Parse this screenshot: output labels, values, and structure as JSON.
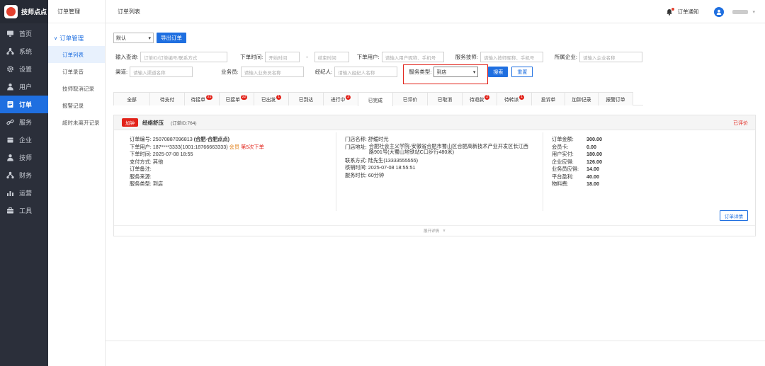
{
  "app": {
    "name": "技师点点"
  },
  "sidebar": {
    "items": [
      {
        "label": "首页",
        "icon": "monitor-icon"
      },
      {
        "label": "系统",
        "icon": "org-icon"
      },
      {
        "label": "设置",
        "icon": "gear-icon"
      },
      {
        "label": "用户",
        "icon": "user-icon"
      },
      {
        "label": "订单",
        "icon": "order-icon",
        "active": true
      },
      {
        "label": "服务",
        "icon": "link-icon"
      },
      {
        "label": "企业",
        "icon": "building-icon"
      },
      {
        "label": "技师",
        "icon": "user-icon"
      },
      {
        "label": "财务",
        "icon": "org-icon"
      },
      {
        "label": "运营",
        "icon": "chart-icon"
      },
      {
        "label": "工具",
        "icon": "briefcase-icon"
      }
    ]
  },
  "subnav": {
    "header": "订单管理",
    "group": "订单管理",
    "items": [
      {
        "label": "订单列表",
        "active": true
      },
      {
        "label": "订单录音"
      },
      {
        "label": "技师取消记录"
      },
      {
        "label": "报警记录"
      },
      {
        "label": "超时未离开记录"
      }
    ]
  },
  "header": {
    "title": "订单列表",
    "notification": "订单通知"
  },
  "toolbar": {
    "default_select": "默认",
    "export_button": "导出订单"
  },
  "filters": {
    "query_label": "输入查询:",
    "query_placeholder": "订单ID/订单编号/联系方式",
    "time_label": "下单时间:",
    "start_placeholder": "开始时间",
    "range_sep": "-",
    "end_placeholder": "结束时间",
    "user_label": "下单用户:",
    "user_placeholder": "请输入用户昵称、手机号",
    "tech_label": "服务技师:",
    "tech_placeholder": "请输入技师昵称、手机号",
    "company_label": "所属企业:",
    "company_placeholder": "请输入企业名称",
    "channel_label": "渠道:",
    "channel_placeholder": "请输入渠道名称",
    "salesman_label": "业务员:",
    "salesman_placeholder": "请输入业务员名称",
    "broker_label": "经纪人:",
    "broker_placeholder": "请输入经纪人名称",
    "service_type_label": "服务类型:",
    "service_type_value": "到店",
    "search_button": "搜索",
    "reset_button": "重置"
  },
  "tabs": [
    {
      "label": "全部",
      "w": 52
    },
    {
      "label": "待支付",
      "w": 50
    },
    {
      "label": "待接单",
      "badge": "21",
      "w": 50
    },
    {
      "label": "已接单",
      "badge": "22",
      "w": 50
    },
    {
      "label": "已出发",
      "badge": "1",
      "w": 50
    },
    {
      "label": "已到达",
      "w": 50
    },
    {
      "label": "进行中",
      "badge": "2",
      "w": 50
    },
    {
      "label": "已完成",
      "active": true,
      "w": 50
    },
    {
      "label": "已评价",
      "w": 50
    },
    {
      "label": "已取消",
      "w": 50
    },
    {
      "label": "待退款",
      "badge": "2",
      "w": 50
    },
    {
      "label": "待转派",
      "badge": "1",
      "w": 50
    },
    {
      "label": "投诉单",
      "w": 48
    },
    {
      "label": "加钟记录",
      "w": 48
    },
    {
      "label": "报警订单",
      "w": 50
    }
  ],
  "order": {
    "tag": "加钟",
    "shop_name": "经络舒压",
    "order_id": "(订单ID:764)",
    "status": "已评价",
    "left": {
      "order_no_label": "订单编号:",
      "order_no": "25070887096813",
      "order_no_city": "(合肥-合肥点点)",
      "user_label": "下单用户:",
      "user": "187****3333(1001:18766663333)",
      "member": "会员",
      "order_count": "第5次下单",
      "time_label": "下单时间:",
      "time": "2025-07-08 18:55",
      "pay_label": "支付方式:",
      "pay": "其他",
      "remark_label": "订单备注:",
      "remark": "",
      "source_label": "服务来源:",
      "source": "",
      "type_label": "服务类型:",
      "type": "到店"
    },
    "middle": {
      "store_label": "门店名称:",
      "store": "舒缓时光",
      "addr_label": "门店地址:",
      "addr": "合肥社会主义学院-安徽省合肥市蜀山区合肥高新技术产业开发区长江西路901号(大蜀山地铁站C口步行480米)",
      "contact_label": "联系方式:",
      "contact": "陆先生(13333555555)",
      "verify_label": "核销时间:",
      "verify": "2025-07-08 18:55:51",
      "duration_label": "服务时长:",
      "duration": "60分钟"
    },
    "right": [
      {
        "label": "订单金额:",
        "value": "300.00"
      },
      {
        "label": "会员卡:",
        "value": "0.00"
      },
      {
        "label": "用户实付:",
        "value": "180.00"
      },
      {
        "label": "企业应得:",
        "value": "126.00"
      },
      {
        "label": "业务员应得:",
        "value": "14.00"
      },
      {
        "label": "平台盈利:",
        "value": "40.00"
      },
      {
        "label": "物料费:",
        "value": "18.00"
      }
    ],
    "detail_button": "订单详情",
    "expand_label": "展开详情"
  }
}
